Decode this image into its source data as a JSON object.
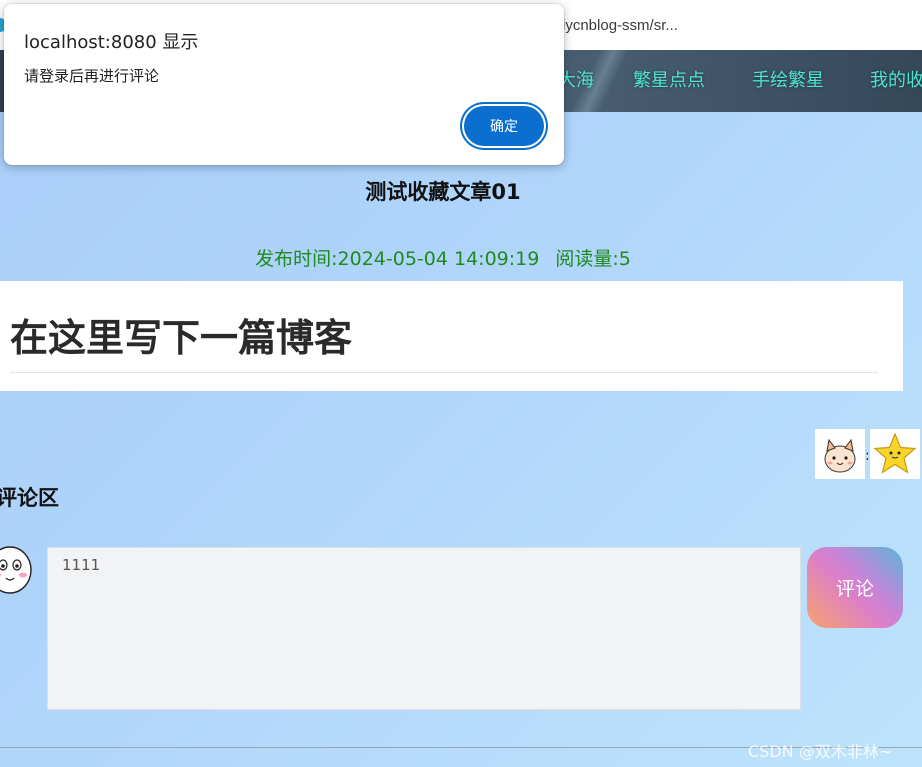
{
  "browser": {
    "address": "iycnblog-ssm/sr..."
  },
  "nav": {
    "items": [
      {
        "label": "大海"
      },
      {
        "label": "繁星点点"
      },
      {
        "label": "手绘繁星"
      },
      {
        "label": "我的收"
      }
    ]
  },
  "dialog": {
    "origin": "localhost:8080 显示",
    "message": "请登录后再进行评论",
    "ok_label": "确定",
    "accent_color": "#0b6fd0"
  },
  "article": {
    "title": "测试收藏文章01",
    "publish_label": "发布时间:",
    "publish_time": "2024-05-04 14:09:19",
    "read_label": "阅读量:",
    "read_count": "5",
    "body_heading": "在这里写下一篇博客"
  },
  "reactions": {
    "separator": ":",
    "stickers": [
      "cat-sticker",
      "star-sticker"
    ]
  },
  "comments": {
    "title": "评论区",
    "input_value": "1111",
    "submit_label": "评论"
  },
  "watermark": "CSDN @双木非林~"
}
